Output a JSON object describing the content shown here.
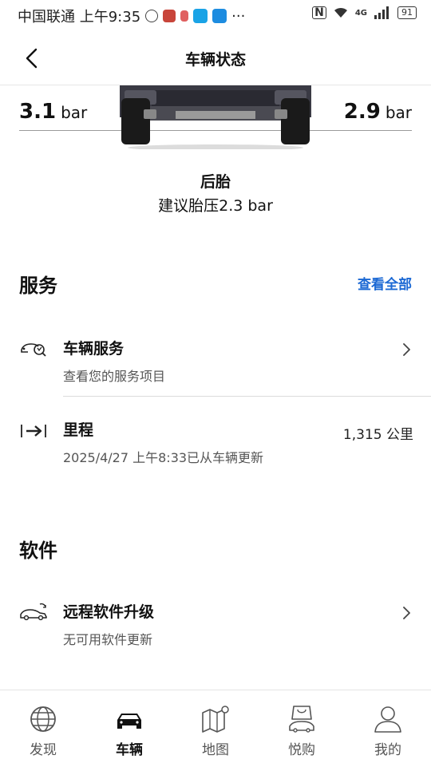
{
  "status_bar": {
    "carrier_time": "中国联通 上午9:35",
    "more": "···",
    "network": "4G",
    "battery": "91"
  },
  "header": {
    "title": "车辆状态"
  },
  "tires": {
    "left_pressure": "3.1",
    "right_pressure": "2.9",
    "unit": "bar",
    "label": "后胎",
    "recommendation": "建议胎压2.3 bar"
  },
  "services": {
    "title": "服务",
    "see_all": "查看全部",
    "items": [
      {
        "title": "车辆服务",
        "subtitle": "查看您的服务项目",
        "icon": "car-service-icon"
      },
      {
        "title": "里程",
        "subtitle": "2025/4/27 上午8:33已从车辆更新",
        "value": "1,315 公里",
        "icon": "mileage-icon"
      }
    ]
  },
  "software": {
    "title": "软件",
    "items": [
      {
        "title": "远程软件升级",
        "subtitle": "无可用软件更新",
        "icon": "remote-update-icon"
      }
    ]
  },
  "nav": {
    "items": [
      {
        "label": "发现",
        "icon": "globe-icon"
      },
      {
        "label": "车辆",
        "icon": "car-icon",
        "active": true
      },
      {
        "label": "地图",
        "icon": "map-icon"
      },
      {
        "label": "悦购",
        "icon": "shopping-icon"
      },
      {
        "label": "我的",
        "icon": "profile-icon"
      }
    ]
  },
  "colors": {
    "accent": "#1c69d4",
    "text": "#111111",
    "muted": "#555555"
  }
}
